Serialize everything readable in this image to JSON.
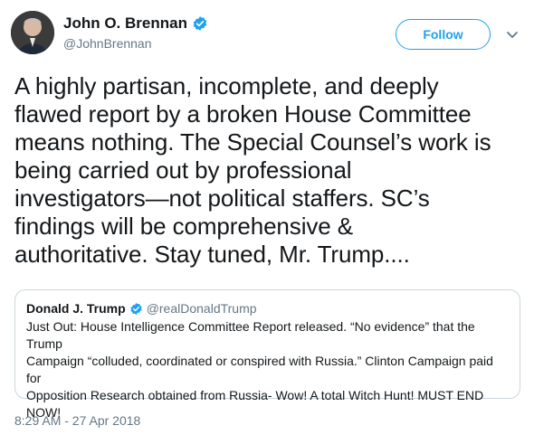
{
  "author": {
    "display_name": "John O. Brennan",
    "handle": "@JohnBrennan",
    "verified_icon": "verified-badge-icon",
    "avatar_icon": "avatar"
  },
  "actions": {
    "follow_label": "Follow",
    "menu_icon": "chevron-down-icon"
  },
  "tweet": {
    "lines": [
      "A highly partisan, incomplete, and deeply",
      "flawed report by a broken House Committee",
      "means nothing. The Special Counsel’s work is",
      "being carried out by professional",
      "investigators—not political staffers. SC’s",
      "findings will be comprehensive &",
      "authoritative. Stay tuned, Mr. Trump...."
    ],
    "timestamp": "8:29 AM - 27 Apr 2018"
  },
  "quoted_tweet": {
    "display_name": "Donald J. Trump",
    "handle": "@realDonaldTrump",
    "lines": [
      "Just Out: House Intelligence Committee Report released. “No evidence” that the Trump",
      "Campaign “colluded, coordinated or conspired with Russia.” Clinton Campaign paid for",
      "Opposition Research obtained from Russia- Wow! A total Witch Hunt! MUST END",
      "NOW!"
    ]
  },
  "colors": {
    "accent": "#1da1f2",
    "text": "#14171a",
    "muted": "#657786",
    "border": "#ccd6dd"
  }
}
